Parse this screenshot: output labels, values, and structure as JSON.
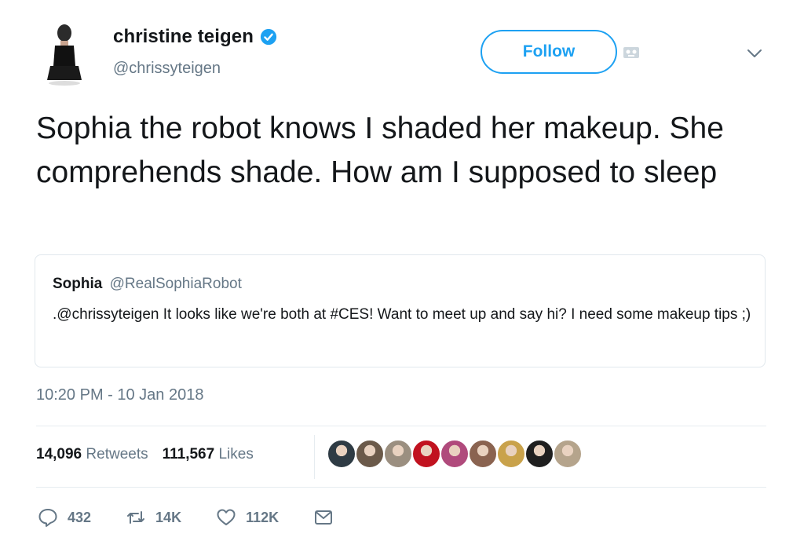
{
  "header": {
    "name": "christine teigen",
    "handle": "@chrissyteigen",
    "follow_label": "Follow"
  },
  "tweet": {
    "text": "Sophia the robot knows I shaded her makeup. She comprehends shade. How am I supposed to sleep",
    "timestamp": "10:20 PM - 10 Jan 2018"
  },
  "quote": {
    "name": "Sophia",
    "handle": "@RealSophiaRobot",
    "text": ".@chrissyteigen It looks like we're both at #CES! Want to meet up and say hi? I need some makeup tips ;)"
  },
  "stats": {
    "retweets_count": "14,096",
    "retweets_label": "Retweets",
    "likes_count": "111,567",
    "likes_label": "Likes"
  },
  "liker_avatars": [
    {
      "color": "#2e3b44"
    },
    {
      "color": "#6b5a4a"
    },
    {
      "color": "#9b8f80"
    },
    {
      "color": "#c1121f"
    },
    {
      "color": "#b04a7c"
    },
    {
      "color": "#8a6350"
    },
    {
      "color": "#c9a24b"
    },
    {
      "color": "#1f1f1f"
    },
    {
      "color": "#b5a48c"
    }
  ],
  "actions": {
    "replies": "432",
    "retweets": "14K",
    "likes": "112K"
  },
  "colors": {
    "accent": "#1da1f2",
    "muted": "#657786",
    "text": "#14171a"
  }
}
